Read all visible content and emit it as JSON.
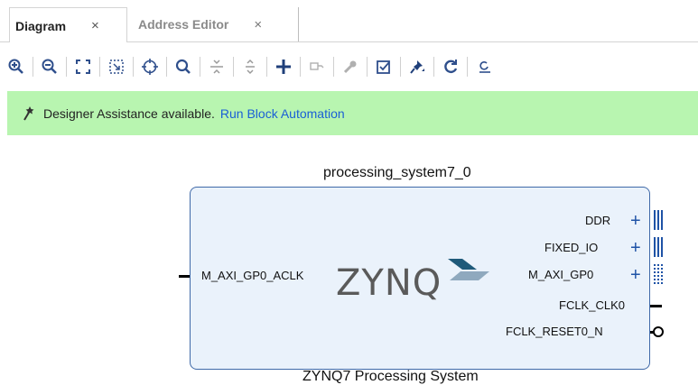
{
  "tabs": [
    {
      "label": "Diagram",
      "close": "×"
    },
    {
      "label": "Address Editor",
      "close": "×"
    }
  ],
  "toolbar": {
    "buttons": [
      "zoom-in-icon",
      "zoom-out-icon",
      "fit-icon",
      "zoom-selection-icon",
      "center-icon",
      "search-icon",
      "collapse-icon",
      "expand-icon",
      "add-ip-icon",
      "validate-icon",
      "wrench-icon",
      "regenerate-icon",
      "pin-icon",
      "refresh-icon",
      "more-icon"
    ]
  },
  "banner": {
    "message": "Designer Assistance available.",
    "link": "Run Block Automation",
    "color": "#b8f5b0"
  },
  "block": {
    "title": "processing_system7_0",
    "logo": "ZYNQ",
    "bottom_label": "ZYNQ7 Processing System",
    "input_ports": [
      "M_AXI_GP0_ACLK"
    ],
    "output_ports": [
      {
        "name": "DDR",
        "type": "bus"
      },
      {
        "name": "FIXED_IO",
        "type": "bus"
      },
      {
        "name": "M_AXI_GP0",
        "type": "bus"
      },
      {
        "name": "FCLK_CLK0",
        "type": "wire"
      },
      {
        "name": "FCLK_RESET0_N",
        "type": "wire"
      }
    ],
    "accent": "#1f53a6"
  }
}
